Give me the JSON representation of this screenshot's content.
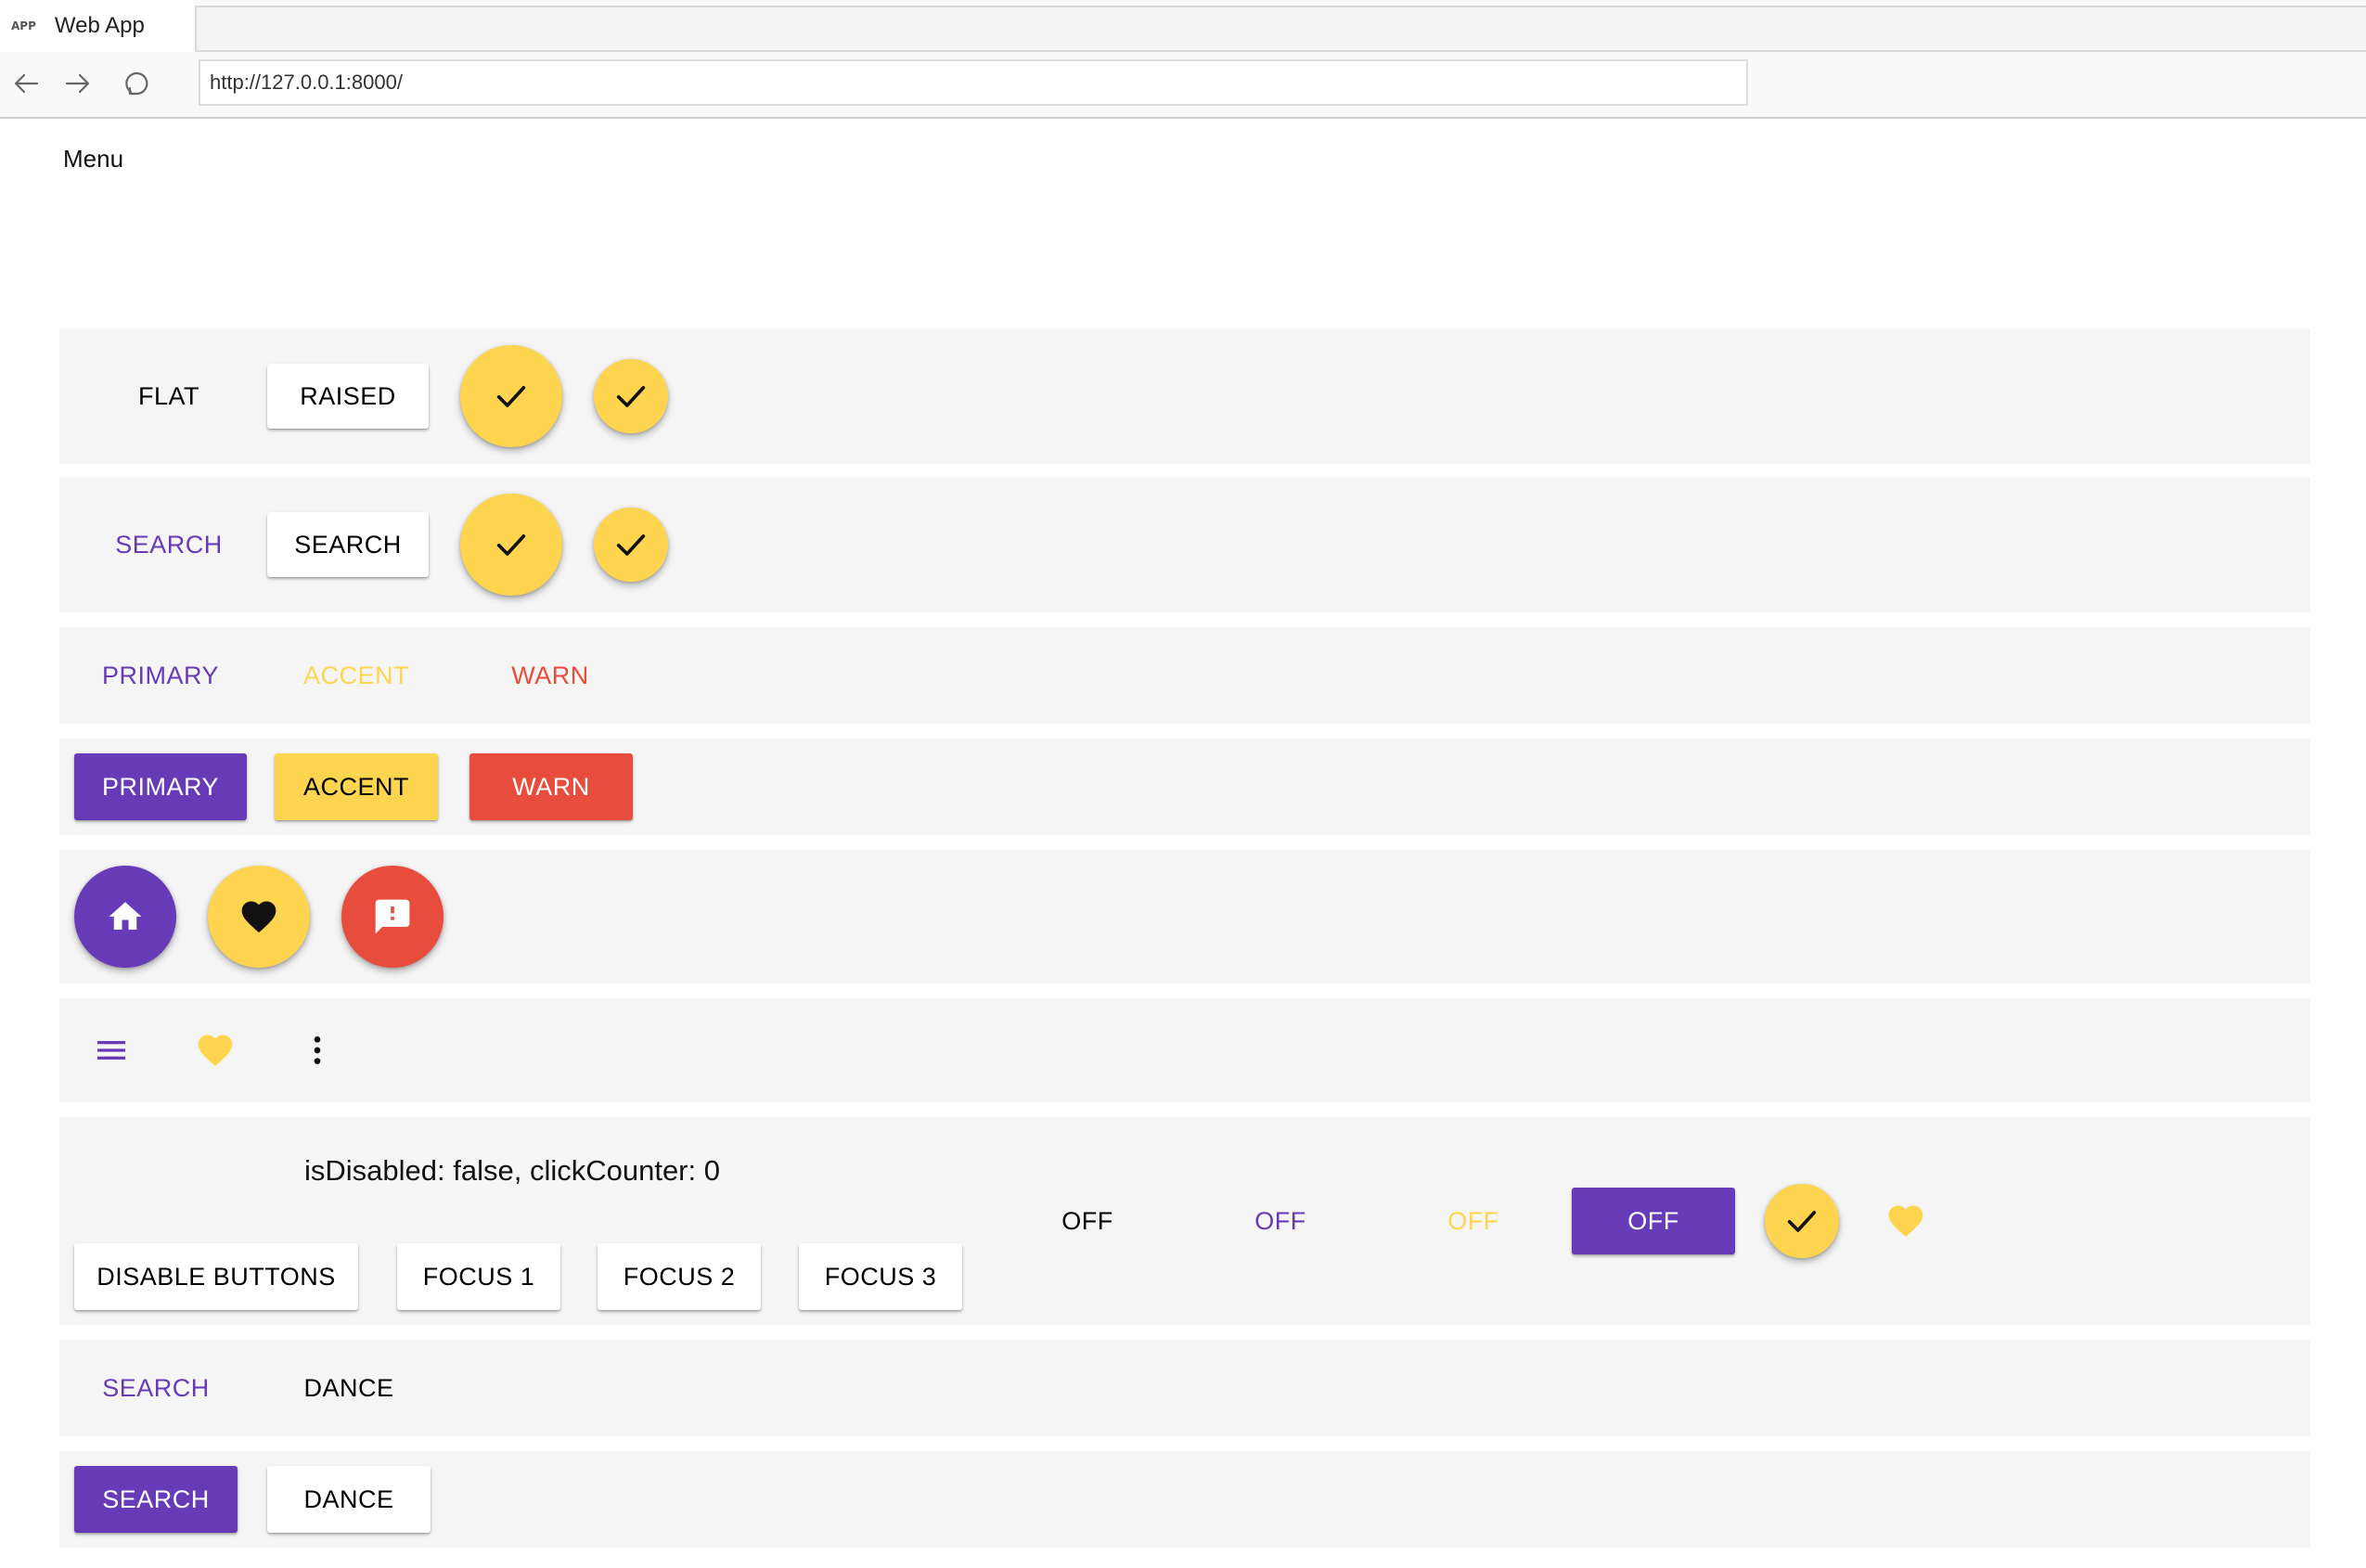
{
  "browser": {
    "tab_icon": "APP",
    "tab_title": "Web App",
    "url": "http://127.0.0.1:8000/",
    "icons": [
      "back-arrow-icon",
      "forward-arrow-icon",
      "reload-icon"
    ]
  },
  "page": {
    "menu_label": "Menu"
  },
  "colors": {
    "primary": "#673ab7",
    "accent": "#ffd54f",
    "warn": "#e74c3c",
    "row_background": "#f5f5f5",
    "page_background": "#ffffff"
  },
  "row1": {
    "flat": "FLAT",
    "raised": "RAISED",
    "icons": [
      "check-icon",
      "check-icon"
    ]
  },
  "row2": {
    "flat": "SEARCH",
    "raised": "SEARCH",
    "icons": [
      "check-icon",
      "check-icon"
    ]
  },
  "row3": {
    "primary": "PRIMARY",
    "accent": "ACCENT",
    "warn": "WARN"
  },
  "row4": {
    "primary": "PRIMARY",
    "accent": "ACCENT",
    "warn": "WARN"
  },
  "row5": {
    "icons": [
      "home-icon",
      "heart-icon",
      "feedback-icon"
    ]
  },
  "row6": {
    "icons": [
      "menu-icon",
      "heart-icon",
      "more-vert-icon"
    ]
  },
  "row7": {
    "status": "isDisabled: false, clickCounter: 0",
    "disable_buttons": "DISABLE BUTTONS",
    "focus1": "FOCUS 1",
    "focus2": "FOCUS 2",
    "focus3": "FOCUS 3",
    "toggle1": "OFF",
    "toggle2": "OFF",
    "toggle3": "OFF",
    "toggle4": "OFF",
    "icons": [
      "check-icon",
      "heart-icon"
    ]
  },
  "row8": {
    "search": "SEARCH",
    "dance": "DANCE"
  },
  "row9": {
    "search": "SEARCH",
    "dance": "DANCE"
  }
}
